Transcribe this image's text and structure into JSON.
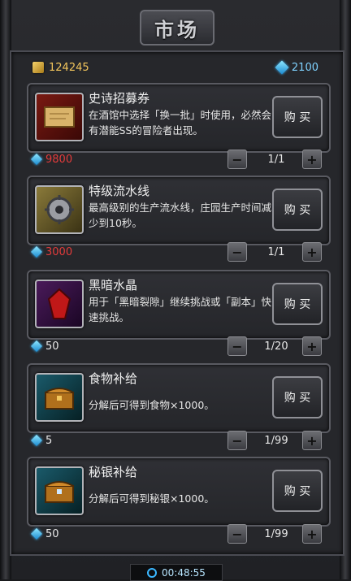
{
  "title": "市场",
  "currencies": {
    "gold": "124245",
    "gems": "2100"
  },
  "items": [
    {
      "name": "史诗招募券",
      "desc": "在酒馆中选择「换一批」时使用，必然会有潜能SS的冒险者出现。",
      "buy_label": "购 买",
      "price": "9800",
      "price_color": "#e23b3b",
      "qty": "1/1",
      "icon": "scroll-icon"
    },
    {
      "name": "特级流水线",
      "desc": "最高级别的生产流水线，庄园生产时间减少到10秒。",
      "buy_label": "购 买",
      "price": "3000",
      "price_color": "#e23b3b",
      "qty": "1/1",
      "icon": "gear-icon"
    },
    {
      "name": "黑暗水晶",
      "desc": "用于「黑暗裂隙」继续挑战或「副本」快速挑战。",
      "buy_label": "购 买",
      "price": "50",
      "price_color": "#e8e8e8",
      "qty": "1/20",
      "icon": "dark-crystal-icon"
    },
    {
      "name": "食物补给",
      "desc": "分解后可得到食物×1000。",
      "buy_label": "购 买",
      "price": "5",
      "price_color": "#e8e8e8",
      "qty": "1/99",
      "icon": "food-chest-icon"
    },
    {
      "name": "秘银补给",
      "desc": "分解后可得到秘银×1000。",
      "buy_label": "购 买",
      "price": "50",
      "price_color": "#e8e8e8",
      "qty": "1/99",
      "icon": "mithril-chest-icon"
    }
  ],
  "timer": "00:48:55"
}
